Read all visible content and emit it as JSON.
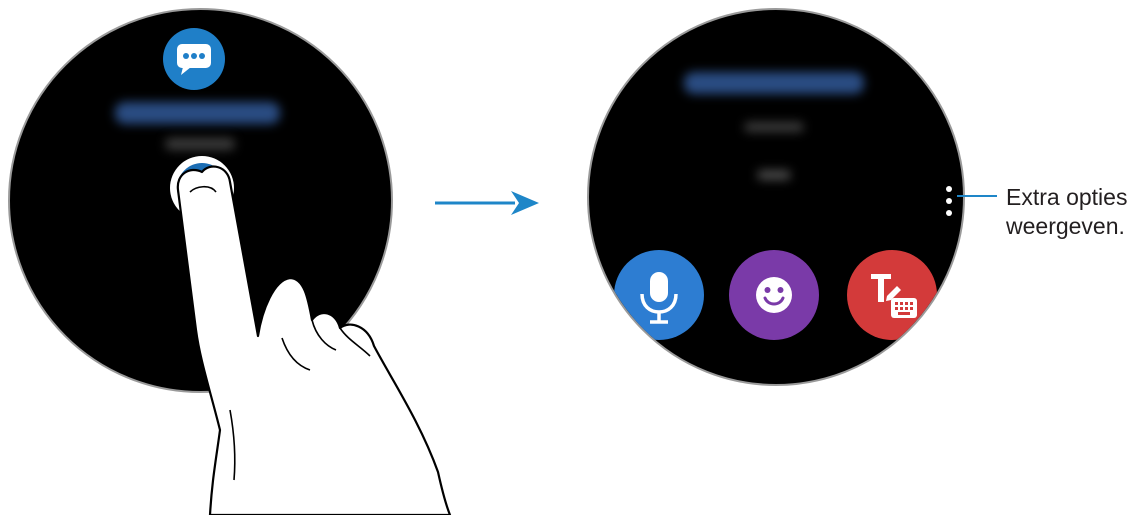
{
  "callout": {
    "line1": "Extra opties",
    "line2": "weergeven."
  },
  "colors": {
    "message_badge": "#1f7fc8",
    "voice_button": "#2d7dd2",
    "emoji_button": "#7a3aa8",
    "keyboard_button": "#d33a3a",
    "arrow": "#1e86c8"
  },
  "icons": {
    "left_badge": "chat-bubble-icon",
    "voice": "microphone-icon",
    "emoji": "smiley-icon",
    "keyboard": "text-keyboard-icon",
    "more": "more-options-icon"
  }
}
